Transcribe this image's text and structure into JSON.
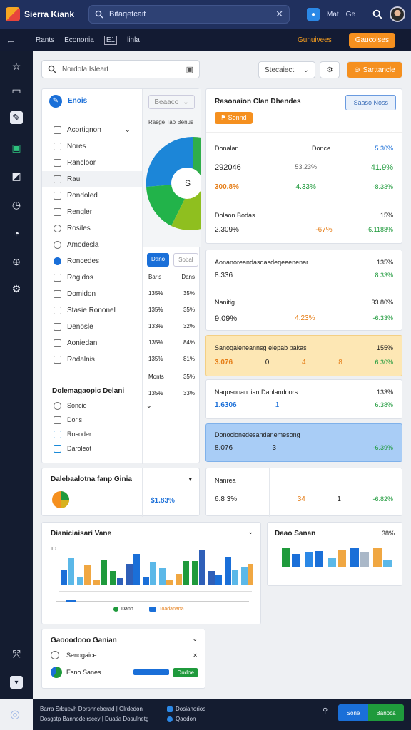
{
  "topbar": {
    "app_title": "Sierra Kiank",
    "search_value": "Bitaqetcait",
    "link1": "Mat",
    "link2": "Ge"
  },
  "subbar": {
    "item1": "Rants",
    "item2": "Econonia",
    "item3": "E1",
    "item4": "linla",
    "right_text": "Gunuivees",
    "button": "Gaucolses"
  },
  "filters": {
    "search_value": "Nordola Isleart",
    "select_value": "Stecaiect",
    "action_button": "Sarttancle"
  },
  "left_panel": {
    "header": "Enois",
    "items": [
      {
        "label": "Acortignon",
        "has_chevron": true
      },
      {
        "label": "Nores"
      },
      {
        "label": "Rancloor"
      },
      {
        "label": "Rau"
      },
      {
        "label": "Rondoled"
      },
      {
        "label": "Rengler"
      },
      {
        "label": "Rosiles"
      },
      {
        "label": "Amodesla"
      },
      {
        "label": "Roncedes"
      },
      {
        "label": "Rogidos"
      },
      {
        "label": "Domidon"
      },
      {
        "label": "Stasie Rononel"
      },
      {
        "label": "Denosle"
      },
      {
        "label": "Aoniedan"
      },
      {
        "label": "Rodalnis"
      }
    ],
    "section2_title": "Dolemagaopic Delani",
    "section2_items": [
      {
        "label": "Soncio",
        "has_chevron": true
      },
      {
        "label": "Doris"
      },
      {
        "label": "Rosoder"
      },
      {
        "label": "Daroleot"
      }
    ]
  },
  "pie_panel": {
    "top_button": "Beaaco",
    "title_line": "Rasge Tao Benus",
    "center_label": "S",
    "tab_active": "Dano",
    "tab_inactive": "Sobal",
    "col1": "Baris",
    "col2": "Dans",
    "rows": [
      [
        "135%",
        "35%"
      ],
      [
        "135%",
        "35%"
      ],
      [
        "133%",
        "32%"
      ],
      [
        "135%",
        "84%"
      ],
      [
        "135%",
        "81%"
      ]
    ],
    "col1b": "Monts",
    "col2b": "35%",
    "row_last": [
      "135%",
      "33%"
    ]
  },
  "right_panel": {
    "title": "Rasonaion Clan Dhendes",
    "badge": "Sonnd",
    "top_button": "Saaso Noss",
    "headers": [
      "Donalan",
      "Donce",
      "5.30%"
    ],
    "row1": [
      "292046",
      "53.23%",
      "41.9%"
    ],
    "row2": [
      "300.8%",
      "4.33%",
      "-8.33%"
    ],
    "block2_label": "Dolaon Bodas",
    "block2_right": "15%",
    "block2_values": [
      "2.309%",
      "-67%",
      "-6.1188%"
    ],
    "block3_title": "Aonanoreandasdasdeqeeenenar",
    "block3_right": "135%",
    "block3_v1": "8.336",
    "block3_v1r": "8.33%",
    "block3_sub": "Nanitig",
    "block3_subr": "33.80%",
    "block3_v2": "9.09%",
    "block3_v2m": "4.23%",
    "block3_v2r": "-6.33%",
    "block4_title": "Sanoqaleneannsg elepab pakas",
    "block4_right": "155%",
    "block4_vals": [
      "3.076",
      "0",
      "4",
      "8",
      "6.30%"
    ],
    "block5_title": "Naqosonan lian Danlandoors",
    "block5_right": "133%",
    "block5_vals": [
      "1.6306",
      "1",
      "6.38%"
    ],
    "block6_title": "Donocionedesandanemesong",
    "block6_vals": [
      "8.076",
      "3",
      "-6.39%"
    ]
  },
  "donut_card": {
    "title": "Dalebaalotna fanp Ginia",
    "value": "$1.83%"
  },
  "mid_card": {
    "label": "Nanrea",
    "values": [
      "6.8 3%",
      "34",
      "1",
      "-6.82%"
    ]
  },
  "bar_card": {
    "title": "Dianiciaisari Vane",
    "legend1": "Dann",
    "legend2": "Toadanana",
    "ytick_top": "10"
  },
  "bar_card2": {
    "title": "Daao Sanan",
    "right": "38%"
  },
  "bottom_card": {
    "title": "Gaooodooo Ganian",
    "item1": "Senogaice",
    "item2": "Esno Sanes",
    "button": "Dudoe"
  },
  "footer": {
    "line1": "Barra Srbuevh Dorsnneberad | Glrdedon",
    "line2": "Dosgstp Bannodelrscey | Duatia Dosulnetg",
    "link1": "Dosianorios",
    "link2": "Qaodon",
    "button1": "Sone",
    "button2": "Banoca"
  },
  "colors": {
    "accent_orange": "#f5901f",
    "accent_blue": "#1a6fd8",
    "accent_green": "#1f9a3c",
    "topbar": "#20305e"
  }
}
